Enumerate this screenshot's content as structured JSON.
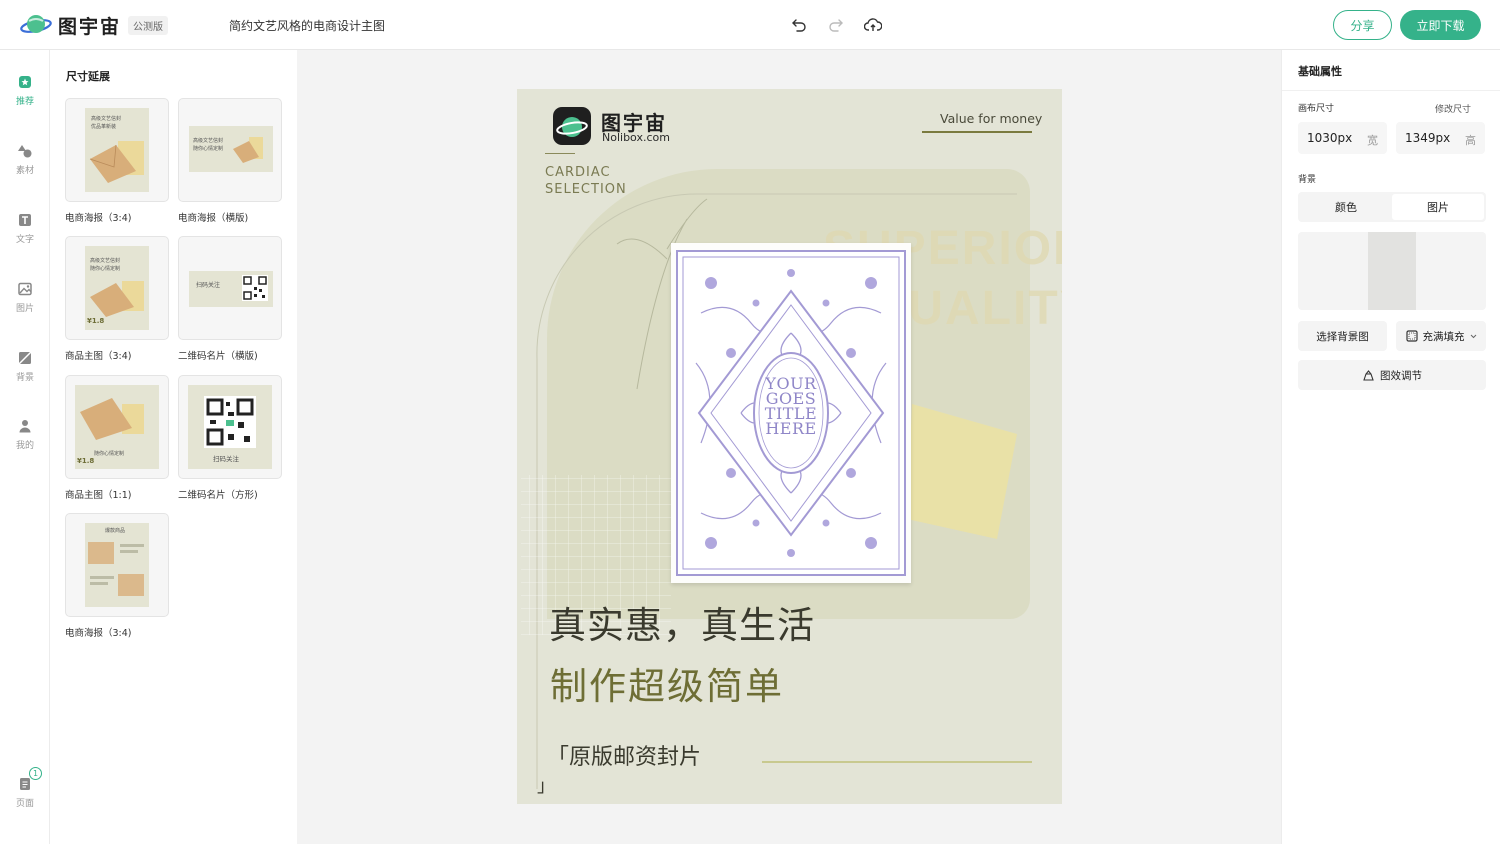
{
  "app": {
    "brand": "图宇宙",
    "badge": "公测版",
    "doc_title": "简约文艺风格的电商设计主图"
  },
  "toolbar": {
    "undo_icon": "undo-icon",
    "redo_icon": "redo-icon",
    "save_icon": "cloud-upload-icon",
    "share_label": "分享",
    "download_label": "立即下载",
    "accent_color": "#35b28a"
  },
  "rail": {
    "items": [
      {
        "label": "推荐",
        "icon": "star-badge-icon",
        "active": true
      },
      {
        "label": "素材",
        "icon": "shapes-icon"
      },
      {
        "label": "文字",
        "icon": "text-icon"
      },
      {
        "label": "图片",
        "icon": "image-icon"
      },
      {
        "label": "背景",
        "icon": "background-icon"
      },
      {
        "label": "我的",
        "icon": "user-icon"
      }
    ],
    "pages_label": "页面",
    "pages_count": "1"
  },
  "left_panel": {
    "title": "尺寸延展",
    "templates": [
      {
        "caption": "电商海报（3:4)",
        "thumb_lines": [
          "高级文艺信封",
          "优品革新装"
        ]
      },
      {
        "caption": "电商海报（横版)",
        "thumb_lines": [
          "高级文艺信封",
          "随你心情定制"
        ]
      },
      {
        "caption": "商品主图（3:4)",
        "thumb_lines": [
          "高级文艺信封",
          "随你心情定制",
          "¥1.8"
        ]
      },
      {
        "caption": "二维码名片（横版)",
        "thumb_lines": [
          "扫码关注"
        ]
      },
      {
        "caption": "商品主图（1:1)",
        "thumb_lines": [
          "随你心情定制",
          "¥1.8"
        ]
      },
      {
        "caption": "二维码名片（方形)",
        "thumb_lines": [
          "扫码关注"
        ]
      },
      {
        "caption": "电商海报（3:4)",
        "thumb_lines": [
          "爆款商品"
        ]
      }
    ]
  },
  "poster": {
    "logo_cn": "图宇宙",
    "logo_en": "Nolibox.com",
    "tagline": "Value for money",
    "cardiac_line1": "CARDIAC",
    "cardiac_line2": "SELECTION",
    "bg_word1": "SUPERIOR",
    "bg_word2": "QUALITY",
    "card_title_1": "YOUR",
    "card_title_2": "GOES",
    "card_title_3": "TITLE",
    "card_title_4": "HERE",
    "headline_1": "真实惠，真生活",
    "headline_2": "制作超级简单",
    "subline_open": "「原版邮资封片",
    "subline_close": "」",
    "bg_color": "#e3e4d6",
    "accent_olive": "#7a7a3e",
    "lavender": "#a39ad4"
  },
  "right_panel": {
    "title": "基础属性",
    "canvas_size_label": "画布尺寸",
    "edit_size_link": "修改尺寸",
    "width_value": "1030px",
    "width_unit": "宽",
    "height_value": "1349px",
    "height_unit": "高",
    "background_label": "背景",
    "tab_color": "颜色",
    "tab_image": "图片",
    "select_bg_label": "选择背景图",
    "fill_mode_label": "充满填充",
    "effects_label": "图效调节"
  }
}
